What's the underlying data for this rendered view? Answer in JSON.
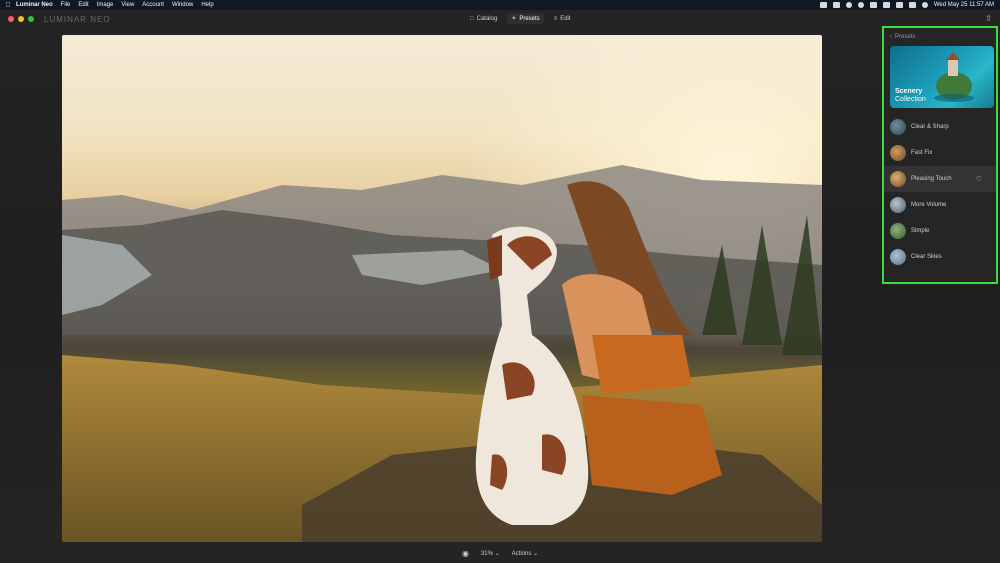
{
  "menubar": {
    "app_name": "Luminar Neo",
    "menus": [
      "File",
      "Edit",
      "Image",
      "View",
      "Account",
      "Window",
      "Help"
    ],
    "clock": "Wed May 25  11:57 AM"
  },
  "titlebar": {
    "logo": "LUMINAR NEO",
    "tabs": [
      {
        "label": "Catalog",
        "icon": "catalog-icon"
      },
      {
        "label": "Presets",
        "icon": "presets-icon",
        "active": true
      },
      {
        "label": "Edit",
        "icon": "edit-icon"
      }
    ]
  },
  "bottom": {
    "zoom": "31%",
    "actions": "Actions"
  },
  "presets_panel": {
    "back_label": "Presets",
    "featured": {
      "title": "Scenery",
      "subtitle": "Collection"
    },
    "items": [
      {
        "label": "Clear & Sharp"
      },
      {
        "label": "Fast Fix"
      },
      {
        "label": "Pleasing Touch",
        "active": true
      },
      {
        "label": "More Volume"
      },
      {
        "label": "Simple"
      },
      {
        "label": "Clear Skies"
      }
    ]
  },
  "colors": {
    "highlight_border": "#3ddc3d",
    "active_tab": "#2f2f2f"
  }
}
